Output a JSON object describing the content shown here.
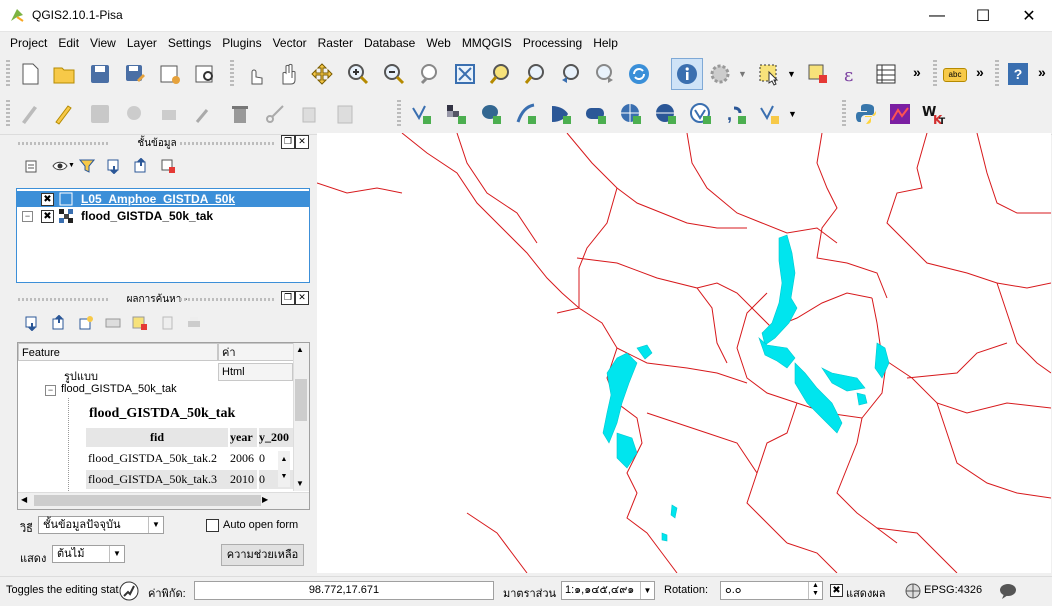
{
  "window": {
    "title": "QGIS2.10.1-Pisa",
    "minimize": "—",
    "maximize": "☐",
    "close": "✕"
  },
  "menu": [
    "Project",
    "Edit",
    "View",
    "Layer",
    "Settings",
    "Plugins",
    "Vector",
    "Raster",
    "Database",
    "Web",
    "MMQGIS",
    "Processing",
    "Help"
  ],
  "toolbar": {
    "more1": "»",
    "more2": "»",
    "more3": "»",
    "abc": "abc",
    "help": "?"
  },
  "layers_panel": {
    "title": "ชั้นข้อมูล",
    "layers": [
      {
        "name": "L05_Amphoe_GISTDA_50k",
        "checked": "✖",
        "selected": true
      },
      {
        "name": "flood_GISTDA_50k_tak",
        "checked": "✖",
        "selected": false
      }
    ]
  },
  "results_panel": {
    "title": "ผลการค้นหา -",
    "col_feature": "Feature",
    "col_value": "ค่า",
    "row_format": "รูปแบบ",
    "row_format_value": "Html",
    "tree_item": "flood_GISTDA_50k_tak",
    "html_title": "flood_GISTDA_50k_tak",
    "table_headers": [
      "fid",
      "year",
      "y_200"
    ],
    "table_rows": [
      [
        "flood_GISTDA_50k_tak.2",
        "2006",
        "0"
      ],
      [
        "flood_GISTDA_50k_tak.3",
        "2010",
        "0"
      ]
    ],
    "mode_label": "วิธี",
    "mode_value": "ชั้นข้อมูลปัจจุบัน",
    "auto_open": "Auto open form",
    "view_label": "แสดง",
    "view_value": "ต้นไม้",
    "help_button": "ความช่วยเหลือ"
  },
  "statusbar": {
    "message": "Toggles the editing stat",
    "coord_label": "ค่าพิกัด:",
    "coord_value": "98.772,17.671",
    "scale_label": "มาตราส่วน",
    "scale_value": "1:๑,๑๔๕,๔๙๑",
    "rotation_label": "Rotation:",
    "rotation_value": "๐.๐",
    "render_label": "แสดงผล",
    "render_checked": "✖",
    "crs": "EPSG:4326"
  },
  "colors": {
    "boundary": "#d7191c",
    "flood": "#00e5ee",
    "selection": "#3c8fd8"
  }
}
